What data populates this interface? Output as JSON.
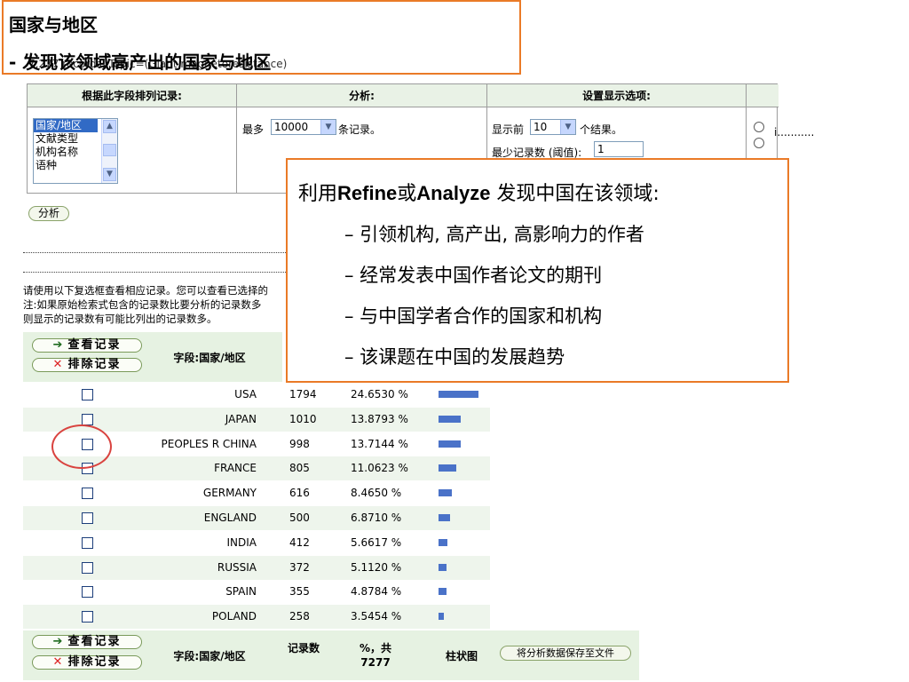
{
  "title": {
    "line1": "国家与地区",
    "line2": "- 发现该领域高产出的国家与地区",
    "records_overlap": "7,277 records. Topic=(Giant magnetoresistance)"
  },
  "options": {
    "col1_header": "根据此字段排列记录:",
    "col2_header": "分析:",
    "col3_header": "设置显示选项:",
    "field_list": [
      "国家/地区",
      "文献类型",
      "机构名称",
      "语种"
    ],
    "max_label": "最多",
    "max_value": "10000",
    "max_suffix": "条记录。",
    "show_top_label": "显示前",
    "show_top_value": "10",
    "show_top_suffix": "个结果。",
    "min_records_label": "最少记录数 (阈值):",
    "min_records_value": "1",
    "radio_label_partial": "i..........."
  },
  "analyze_button": "分析",
  "notes": [
    "请使用以下复选框查看相应记录。您可以查看已选择的",
    "注:如果原始检索式包含的记录数比要分析的记录数多",
    "则显示的记录数有可能比列出的记录数多。"
  ],
  "table": {
    "view_records": "查看记录",
    "exclude_records": "排除记录",
    "field_header": "字段:国家/地区",
    "count_header": "记录数",
    "percent_header": "%，共 7277",
    "bar_header": "柱状图",
    "save_button": "将分析数据保存至文件",
    "rows": [
      {
        "country": "USA",
        "count": "1794",
        "percent": "24.6530 %",
        "fraction": 0.24653
      },
      {
        "country": "JAPAN",
        "count": "1010",
        "percent": "13.8793 %",
        "fraction": 0.138793
      },
      {
        "country": "PEOPLES R CHINA",
        "count": "998",
        "percent": "13.7144 %",
        "fraction": 0.137144
      },
      {
        "country": "FRANCE",
        "count": "805",
        "percent": "11.0623 %",
        "fraction": 0.110623
      },
      {
        "country": "GERMANY",
        "count": "616",
        "percent": "8.4650 %",
        "fraction": 0.08465
      },
      {
        "country": "ENGLAND",
        "count": "500",
        "percent": "6.8710 %",
        "fraction": 0.06871
      },
      {
        "country": "INDIA",
        "count": "412",
        "percent": "5.6617 %",
        "fraction": 0.056617
      },
      {
        "country": "RUSSIA",
        "count": "372",
        "percent": "5.1120 %",
        "fraction": 0.05112
      },
      {
        "country": "SPAIN",
        "count": "355",
        "percent": "4.8784 %",
        "fraction": 0.048784
      },
      {
        "country": "POLAND",
        "count": "258",
        "percent": "3.5454 %",
        "fraction": 0.035454
      }
    ]
  },
  "callout": {
    "title_pre": "利用",
    "title_refine": "Refine",
    "title_or": "或",
    "title_analyze": "Analyze",
    "title_post": " 发现中国在该领域:",
    "bullets": [
      "– 引领机构, 高产出, 高影响力的作者",
      "– 经常发表中国作者论文的期刊",
      "– 与中国学者合作的国家和机构",
      "– 该课题在中国的发展趋势"
    ]
  },
  "colors": {
    "accent_orange": "#ea7a27",
    "highlight_red": "#d9433f",
    "bar_blue": "#4a72c8",
    "row_green": "#eef5ec"
  }
}
